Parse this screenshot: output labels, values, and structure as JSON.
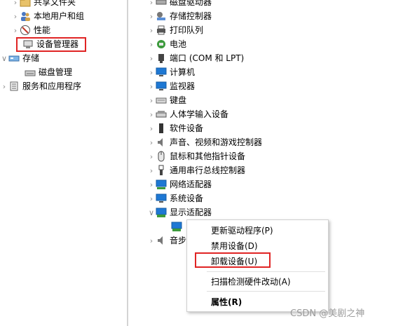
{
  "left_tree": {
    "items": [
      {
        "label": "共享文件夹",
        "icon": "shared-folder-icon"
      },
      {
        "label": "本地用户和组",
        "icon": "users-icon"
      },
      {
        "label": "性能",
        "icon": "performance-icon"
      },
      {
        "label": "设备管理器",
        "icon": "device-manager-icon"
      },
      {
        "label": "存储",
        "icon": "storage-icon"
      },
      {
        "label": "磁盘管理",
        "icon": "disk-management-icon"
      },
      {
        "label": "服务和应用程序",
        "icon": "services-icon"
      }
    ]
  },
  "device_tree": {
    "items": [
      {
        "label": "磁盘驱动器",
        "icon": "disk-drive-icon"
      },
      {
        "label": "存储控制器",
        "icon": "storage-controller-icon"
      },
      {
        "label": "打印队列",
        "icon": "printer-icon"
      },
      {
        "label": "电池",
        "icon": "battery-icon"
      },
      {
        "label": "端口 (COM 和 LPT)",
        "icon": "port-icon"
      },
      {
        "label": "计算机",
        "icon": "computer-icon"
      },
      {
        "label": "监视器",
        "icon": "monitor-icon"
      },
      {
        "label": "键盘",
        "icon": "keyboard-icon"
      },
      {
        "label": "人体学输入设备",
        "icon": "hid-icon"
      },
      {
        "label": "软件设备",
        "icon": "software-device-icon"
      },
      {
        "label": "声音、视频和游戏控制器",
        "icon": "audio-icon"
      },
      {
        "label": "鼠标和其他指针设备",
        "icon": "mouse-icon"
      },
      {
        "label": "通用串行总线控制器",
        "icon": "usb-icon"
      },
      {
        "label": "网络适配器",
        "icon": "network-adapter-icon"
      },
      {
        "label": "系统设备",
        "icon": "system-device-icon"
      },
      {
        "label": "显示适配器",
        "icon": "display-adapter-icon"
      }
    ],
    "partial_item_label": "音步"
  },
  "context_menu": {
    "items": [
      {
        "label": "更新驱动程序(P)"
      },
      {
        "label": "禁用设备(D)"
      },
      {
        "label": "卸载设备(U)"
      },
      {
        "label": "扫描检测硬件改动(A)"
      },
      {
        "label": "属性(R)"
      }
    ]
  },
  "watermark": "CSDN @美剧之神",
  "colors": {
    "highlight": "#e02424",
    "icon_blue": "#1e78d4"
  }
}
